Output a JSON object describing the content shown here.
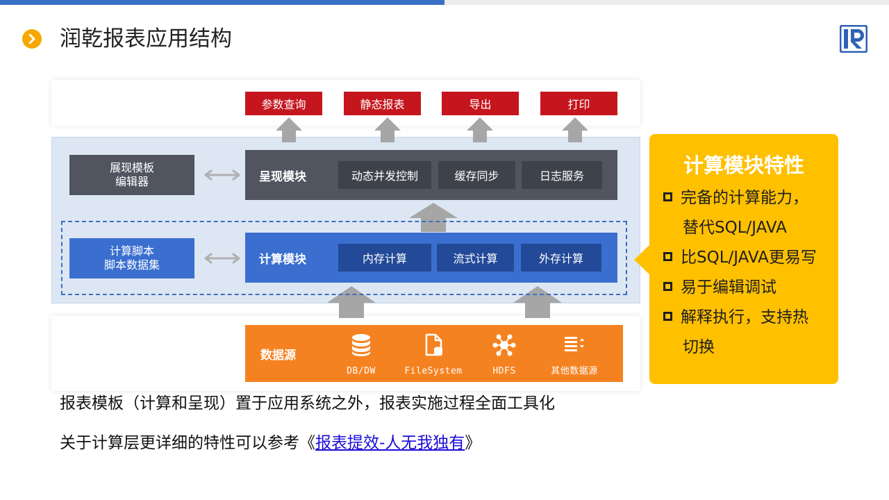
{
  "page_title": "润乾报表应用结构",
  "outputs": [
    "参数查询",
    "静态报表",
    "导出",
    "打印"
  ],
  "presentation": {
    "editor_line1": "展现模板",
    "editor_line2": "编辑器",
    "module_label": "呈现模块",
    "subs": [
      "动态并发控制",
      "缓存同步",
      "日志服务"
    ]
  },
  "compute": {
    "script_line1": "计算脚本",
    "script_line2": "脚本数据集",
    "module_label": "计算模块",
    "subs": [
      "内存计算",
      "流式计算",
      "外存计算"
    ]
  },
  "datasource": {
    "label": "数据源",
    "items": [
      {
        "caption": "DB/DW",
        "icon": "database-icon"
      },
      {
        "caption": "FileSystem",
        "icon": "file-icon"
      },
      {
        "caption": "HDFS",
        "icon": "network-nodes-icon"
      },
      {
        "caption": "其他数据源",
        "icon": "list-icon"
      }
    ]
  },
  "features": {
    "title": "计算模块特性",
    "items": [
      {
        "line1": "完备的计算能力，",
        "line2": "替代SQL/JAVA"
      },
      {
        "line1": "比SQL/JAVA更易写",
        "line2": ""
      },
      {
        "line1": "易于编辑调试",
        "line2": ""
      },
      {
        "line1": "解释执行，支持热",
        "line2": "切换"
      }
    ]
  },
  "notes": {
    "line1": "报表模板（计算和呈现）置于应用系统之外，报表实施过程全面工具化",
    "line2_prefix": "关于计算层更详细的特性可以参考《",
    "line2_link": "报表提效-人无我独有",
    "line2_suffix": "》"
  },
  "colors": {
    "accent_blue": "#3a6fc6",
    "output_red": "#c5161e",
    "presentation_dark": "#505560",
    "compute_blue": "#3a6fd0",
    "datasource_orange": "#f58220",
    "feature_yellow": "#ffc000",
    "title_bullet": "#f5a800"
  }
}
